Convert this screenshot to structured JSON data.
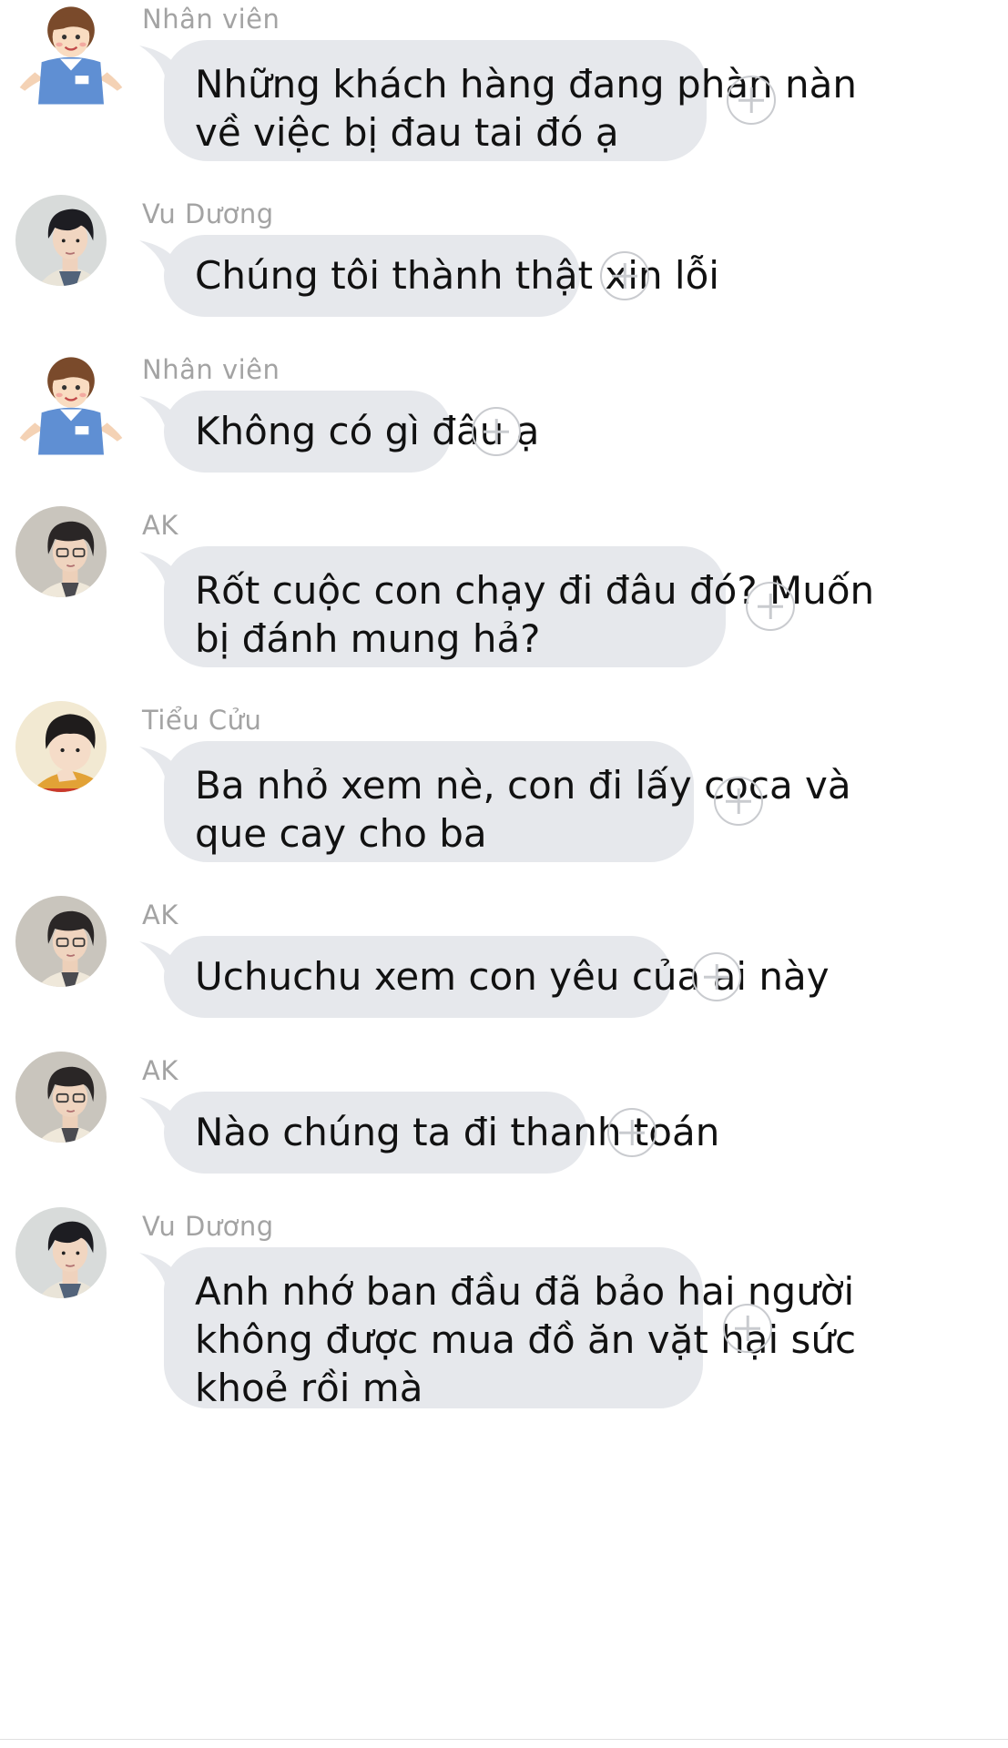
{
  "messages": [
    {
      "sender": "Nhân viên",
      "avatar": "staff-avatar",
      "lines": [
        "Những khách hàng đang phàn nàn",
        "về việc bị đau tai đó ạ"
      ]
    },
    {
      "sender": "Vu Dương",
      "avatar": "vu-duong-avatar",
      "lines": [
        "Chúng tôi thành thật xin lỗi"
      ]
    },
    {
      "sender": "Nhân viên",
      "avatar": "staff-avatar",
      "lines": [
        "Không có gì đâu ạ"
      ]
    },
    {
      "sender": "AK",
      "avatar": "ak-avatar",
      "lines": [
        "Rốt cuộc con chạy đi đâu đó? Muốn",
        "bị đánh mung hả?"
      ]
    },
    {
      "sender": "Tiểu Cửu",
      "avatar": "tieu-cuu-avatar",
      "lines": [
        "Ba nhỏ xem nè, con đi lấy coca và",
        "que cay cho ba"
      ]
    },
    {
      "sender": "AK",
      "avatar": "ak-avatar",
      "lines": [
        "Uchuchu xem con yêu của ai này"
      ]
    },
    {
      "sender": "AK",
      "avatar": "ak-avatar",
      "lines": [
        "Nào chúng ta đi thanh toán"
      ]
    },
    {
      "sender": "Vu Dương",
      "avatar": "vu-duong-avatar",
      "lines": [
        "Anh nhớ ban đầu đã bảo hai người",
        "không được mua đồ ăn vặt hại sức",
        "khoẻ rồi mà"
      ]
    }
  ]
}
